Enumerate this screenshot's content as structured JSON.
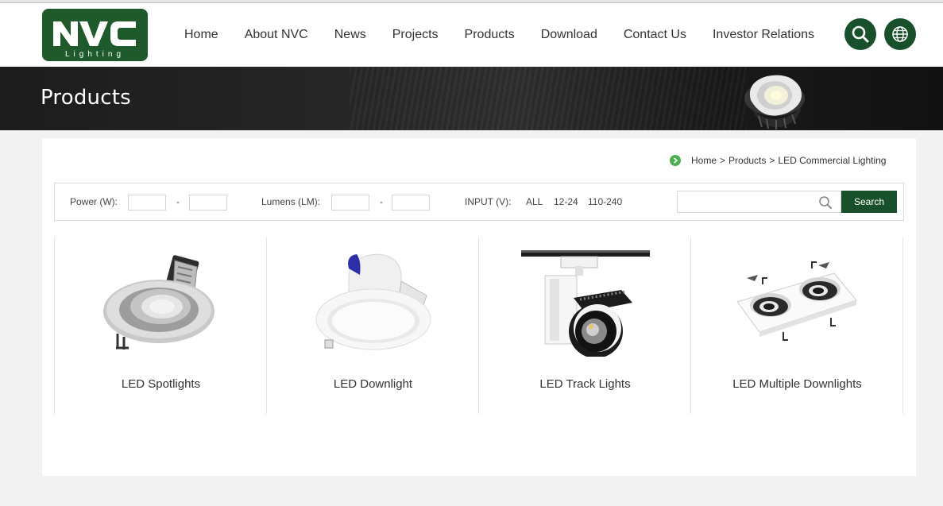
{
  "brand": {
    "logo_text": "NVC",
    "logo_subtext": "Lighting",
    "color": "#1f5a2c"
  },
  "nav": {
    "items": [
      {
        "label": "Home"
      },
      {
        "label": "About NVC"
      },
      {
        "label": "News"
      },
      {
        "label": "Projects"
      },
      {
        "label": "Products"
      },
      {
        "label": "Download"
      },
      {
        "label": "Contact Us"
      },
      {
        "label": "Investor Relations"
      }
    ],
    "search_icon": "search-icon",
    "language_icon": "globe-icon"
  },
  "banner": {
    "title": "Products"
  },
  "breadcrumb": {
    "items": [
      "Home",
      "Products",
      "LED Commercial Lighting"
    ],
    "separator": ">"
  },
  "filter": {
    "power_label": "Power (W):",
    "lumens_label": "Lumens (LM):",
    "dash": "-",
    "input_label": "INPUT (V):",
    "input_options": [
      "ALL",
      "12-24",
      "110-240"
    ],
    "search_placeholder": "",
    "search_button": "Search"
  },
  "products": [
    {
      "name": "LED Spotlights",
      "icon": "spotlight-image"
    },
    {
      "name": "LED Downlight",
      "icon": "downlight-image"
    },
    {
      "name": "LED Track Lights",
      "icon": "track-light-image"
    },
    {
      "name": "LED Multiple Downlights",
      "icon": "multiple-downlights-image"
    }
  ],
  "colors": {
    "accent": "#17502a",
    "bullet": "#4caf50",
    "banner": "#1e1e1e"
  }
}
